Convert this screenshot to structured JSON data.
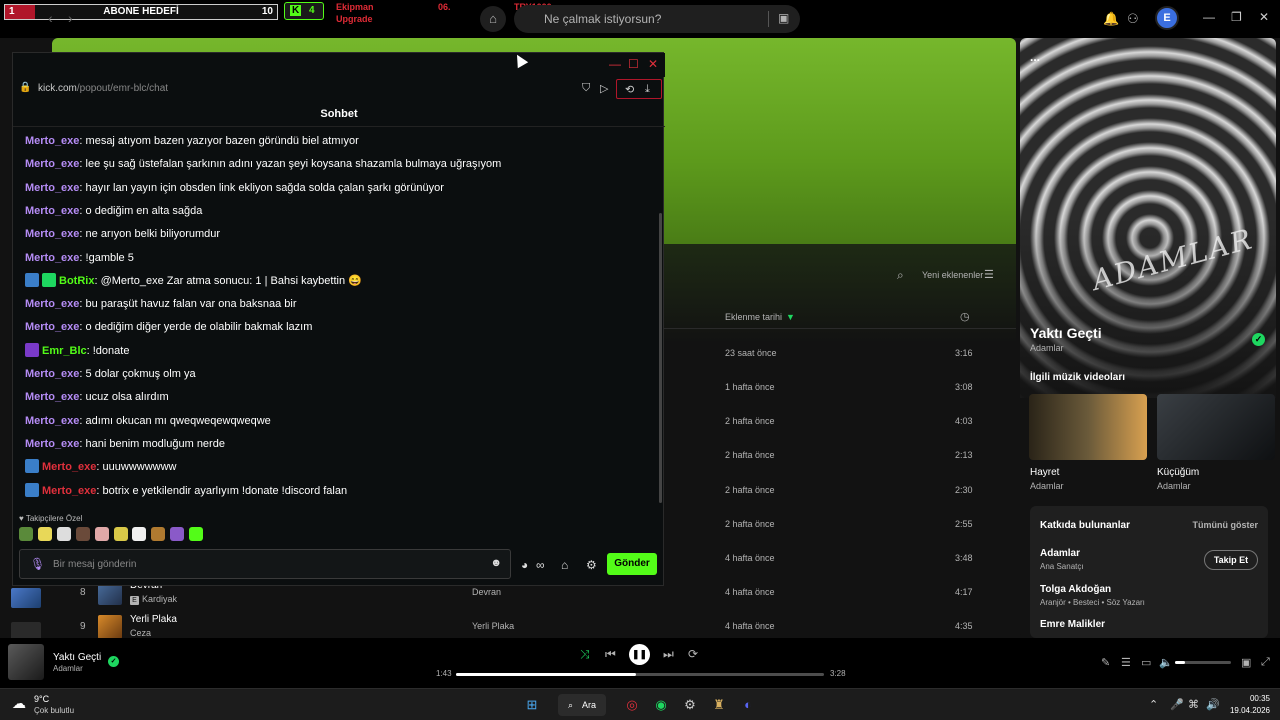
{
  "overlay": {
    "sub_goal_current": "1",
    "sub_goal_label": "ABONE HEDEFİ",
    "sub_goal_target": "10",
    "kick_viewers": "4",
    "alert_line1": "Ekipman",
    "alert_line2": "Upgrade",
    "alert_amount": "06.",
    "alert_currency": "TRY1000"
  },
  "topbar": {
    "search_placeholder": "Ne çalmak istiyorsun?",
    "avatar_letter": "E"
  },
  "tracklist": {
    "sort_label": "Yeni eklenenler",
    "col_date": "Eklenme tarihi",
    "rows": [
      {
        "date": "23 saat önce",
        "duration": "3:16"
      },
      {
        "date": "1 hafta önce",
        "duration": "3:08"
      },
      {
        "date": "2 hafta önce",
        "duration": "4:03"
      },
      {
        "date": "2 hafta önce",
        "duration": "2:13"
      },
      {
        "date": "2 hafta önce",
        "duration": "2:30"
      },
      {
        "date": "2 hafta önce",
        "duration": "2:55"
      },
      {
        "date": "4 hafta önce",
        "duration": "3:48"
      },
      {
        "date": "4 hafta önce",
        "duration": "4:17",
        "num": "8",
        "title": "Devran",
        "artist": "Kardiyak",
        "album": "Devran"
      },
      {
        "date": "4 hafta önce",
        "duration": "4:35",
        "num": "9",
        "title": "Yerli Plaka",
        "artist": "Ceza",
        "album": "Yerli Plaka"
      }
    ]
  },
  "now_playing_panel": {
    "dots": "...",
    "art_text": "ADAMLAR",
    "title": "Yaktı Geçti",
    "artist": "Adamlar",
    "related_title": "İlgili müzik videoları",
    "videos": [
      {
        "title": "Hayret",
        "artist": "Adamlar"
      },
      {
        "title": "Küçüğüm",
        "artist": "Adamlar"
      }
    ],
    "credits_title": "Katkıda bulunanlar",
    "credits_all": "Tümünü göster",
    "follow": "Takip Et",
    "credits": [
      {
        "name": "Adamlar",
        "role": "Ana Sanatçı"
      },
      {
        "name": "Tolga Akdoğan",
        "role": "Aranjör • Besteci • Söz Yazarı"
      },
      {
        "name": "Emre Malikler",
        "role": ""
      }
    ]
  },
  "chat": {
    "url_host": "kick.com",
    "url_path": "/popout/emr-blc/chat",
    "header": "Sohbet",
    "messages": [
      {
        "user": "Merto_exe",
        "text": ": mesaj atıyom bazen yazıyor bazen göründü biel atmıyor",
        "color": "#b58cf5"
      },
      {
        "user": "Merto_exe",
        "text": ": lee şu sağ üstefalan şarkının adını yazan şeyi koysana shazamla bulmaya uğraşıyom",
        "color": "#b58cf5"
      },
      {
        "user": "Merto_exe",
        "text": ": hayır lan yayın için obsden link ekliyon sağda solda çalan şarkı görünüyor",
        "color": "#b58cf5"
      },
      {
        "user": "Merto_exe",
        "text": ": o dediğim en alta sağda",
        "color": "#b58cf5"
      },
      {
        "user": "Merto_exe",
        "text": ": ne arıyon belki biliyorumdur",
        "color": "#b58cf5"
      },
      {
        "user": "Merto_exe",
        "text": ": !gamble 5",
        "color": "#b58cf5"
      },
      {
        "user": "BotRix",
        "text": ": @Merto_exe Zar atma sonucu: 1 | Bahsi kaybettin 😄",
        "color": "#53fc18",
        "badges": 2
      },
      {
        "user": "Merto_exe",
        "text": ": bu paraşüt havuz falan var ona baksnaa bir",
        "color": "#b58cf5"
      },
      {
        "user": "Merto_exe",
        "text": ": o dediğim diğer yerde de olabilir bakmak lazım",
        "color": "#b58cf5"
      },
      {
        "user": "Emr_Blc",
        "text": ": !donate",
        "color": "#53fc18",
        "badges": 1
      },
      {
        "user": "Merto_exe",
        "text": ": 5 dolar çokmuş olm ya",
        "color": "#b58cf5"
      },
      {
        "user": "Merto_exe",
        "text": ": ucuz olsa alırdım",
        "color": "#b58cf5"
      },
      {
        "user": "Merto_exe",
        "text": ": adımı okucan mı qweqweqewqweqwe",
        "color": "#b58cf5"
      },
      {
        "user": "Merto_exe",
        "text": ": hani benim modluğum nerde",
        "color": "#b58cf5"
      },
      {
        "user": "Merto_exe",
        "text": ": uuuwwwwwww",
        "color": "#e0303c",
        "badges": 1
      },
      {
        "user": "Merto_exe",
        "text": ": botrix e yetkilendir ayarlıyım !donate !discord falan",
        "color": "#e0303c",
        "badges": 1
      }
    ],
    "emote_label": "♥ Takipçilere Özel",
    "input_placeholder": "Bir mesaj gönderin",
    "send": "Gönder"
  },
  "player": {
    "title": "Yaktı Geçti",
    "artist": "Adamlar",
    "elapsed": "1:43",
    "total": "3:28",
    "progress": 0.49,
    "volume": 0.18
  },
  "taskbar": {
    "temp": "9°C",
    "weather": "Çok bulutlu",
    "search": "Ara",
    "time": "00:35",
    "date": "19.04.2026"
  },
  "colors": {
    "spotify_green": "#1ed760",
    "kick_green": "#53fc18",
    "hero_green": "#6aa824"
  }
}
